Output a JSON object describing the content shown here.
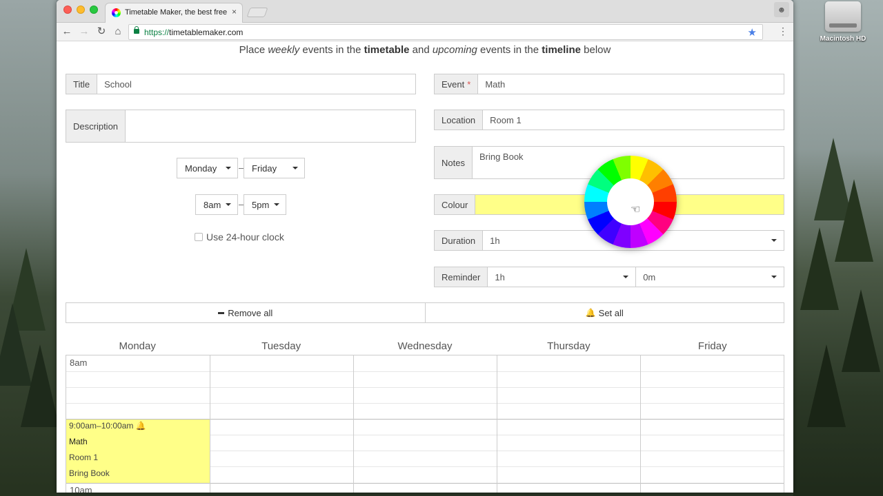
{
  "desktop": {
    "disk_label": "Macintosh HD"
  },
  "browser": {
    "tab_title": "Timetable Maker, the best free",
    "tab_close": "×",
    "url_scheme": "https://",
    "url_host": "timetablemaker.com"
  },
  "page": {
    "subtitle_parts": [
      "Place ",
      "weekly",
      " events in the ",
      "timetable",
      " and ",
      "upcoming",
      " events in the ",
      "timeline",
      " below"
    ]
  },
  "left_form": {
    "title_label": "Title",
    "title_value": "School",
    "description_label": "Description",
    "description_value": "",
    "day_start": "Monday",
    "day_end": "Friday",
    "time_start": "8am",
    "time_end": "5pm",
    "range_dash": "–",
    "clock24_label": "Use 24-hour clock"
  },
  "right_form": {
    "event_label": "Event",
    "event_required_mark": "*",
    "event_value": "Math",
    "location_label": "Location",
    "location_value": "Room 1",
    "notes_label": "Notes",
    "notes_value": "Bring Book",
    "colour_label": "Colour",
    "colour_value": "#ffff88",
    "duration_label": "Duration",
    "duration_value": "1h",
    "reminder_label": "Reminder",
    "reminder_hours": "1h",
    "reminder_minutes": "0m"
  },
  "actions": {
    "remove_all": "Remove all",
    "set_all": "Set all"
  },
  "timetable": {
    "days": [
      "Monday",
      "Tuesday",
      "Wednesday",
      "Thursday",
      "Friday"
    ],
    "hours": [
      "8am",
      "10am"
    ],
    "event": {
      "time": "9:00am–10:00am",
      "name": "Math",
      "location": "Room 1",
      "notes": "Bring Book",
      "colour": "#ffff88"
    }
  },
  "colors": {
    "accent_green": "#0b8043",
    "bookmark_star": "#4a7fe6",
    "required": "#d9534f"
  }
}
